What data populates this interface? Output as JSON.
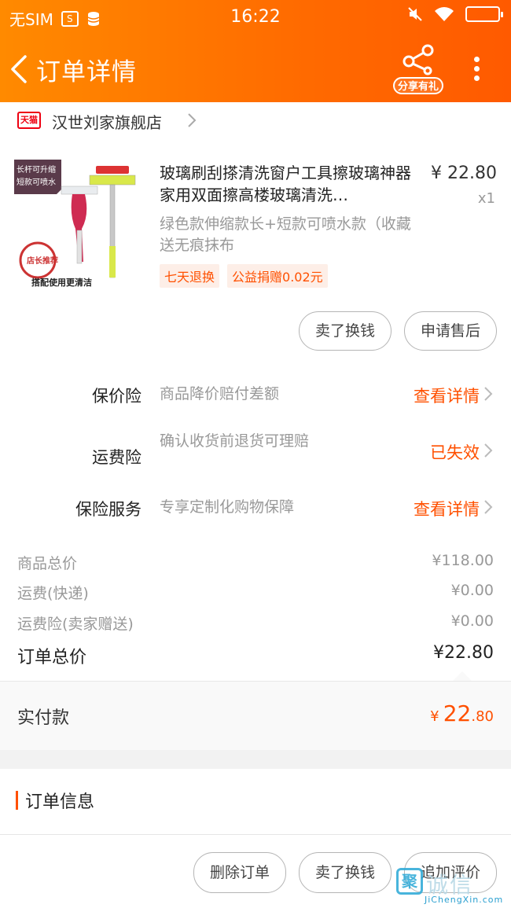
{
  "status_bar": {
    "carrier": "无SIM",
    "time": "16:22"
  },
  "nav": {
    "title": "订单详情",
    "share_label": "分享有礼"
  },
  "store": {
    "badge": "天猫",
    "name": "汉世刘家旗舰店"
  },
  "product": {
    "title": "玻璃刷刮搽清洗窗户工具擦玻璃神器家用双面擦高楼玻璃清洗…",
    "price": "¥ 22.80",
    "qty": "x1",
    "spec": "绿色款伸缩款长+短款可喷水款（收藏送无痕抹布",
    "tags": [
      "七天退换",
      "公益捐赠0.02元"
    ],
    "thumb_texts": [
      "长杆可升缩",
      "短款可喷水",
      "店长推荐",
      "搭配使用更清洁"
    ],
    "buttons": [
      "卖了换钱",
      "申请售后"
    ]
  },
  "insurance": [
    {
      "label": "保价险",
      "desc": "商品降价赔付差额",
      "action": "查看详情"
    },
    {
      "label": "运费险",
      "desc": "确认收货前退货可理赔",
      "action": "已失效"
    },
    {
      "label": "保险服务",
      "desc": "专享定制化购物保障",
      "action": "查看详情"
    }
  ],
  "totals": [
    {
      "label": "商品总价",
      "value": "¥118.00"
    },
    {
      "label": "运费(快递)",
      "value": "¥0.00"
    },
    {
      "label": "运费险(卖家赠送)",
      "value": "¥0.00"
    },
    {
      "label": "订单总价",
      "value": "¥22.80"
    }
  ],
  "paid": {
    "label": "实付款",
    "currency": "¥",
    "integer": "22",
    "decimal": ".80"
  },
  "order_info": {
    "title": "订单信息"
  },
  "footer": {
    "buttons": [
      "删除订单",
      "卖了换钱",
      "追加评价"
    ]
  },
  "watermark": {
    "logo": "聚",
    "cn": "诚信",
    "en": "JiChengXin.com"
  },
  "colors": {
    "header": "#ff7a00",
    "accent": "#ff5000"
  },
  "icons": [
    "sim-card-icon",
    "database-icon",
    "mute-icon",
    "wifi-icon",
    "battery-icon",
    "back-arrow-icon",
    "share-icon",
    "more-vertical-icon",
    "chevron-right-icon"
  ]
}
